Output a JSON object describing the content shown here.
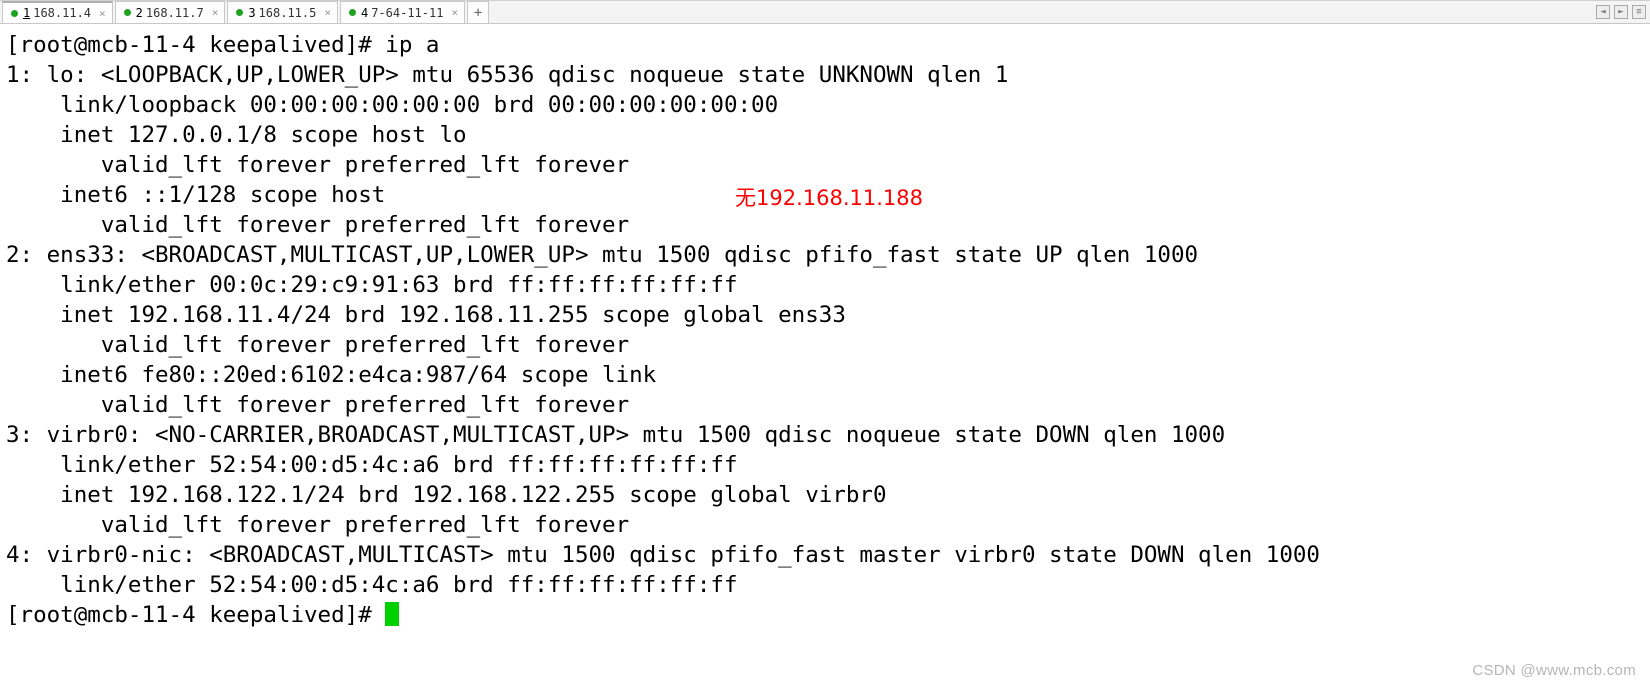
{
  "toolbar": {
    "hint": "",
    "tabs": [
      {
        "num": "1",
        "label": "168.11.4",
        "active": true
      },
      {
        "num": "2",
        "label": "168.11.7",
        "active": false
      },
      {
        "num": "3",
        "label": "168.11.5",
        "active": false
      },
      {
        "num": "4",
        "label": "7-64-11-11",
        "active": false
      }
    ],
    "add": "+",
    "close_glyph": "×",
    "right_icons": {
      "left": "◄",
      "right": "►",
      "menu": "≡"
    }
  },
  "term": {
    "prompt1": "[root@mcb-11-4 keepalived]# ip a",
    "lines": [
      "1: lo: <LOOPBACK,UP,LOWER_UP> mtu 65536 qdisc noqueue state UNKNOWN qlen 1",
      "    link/loopback 00:00:00:00:00:00 brd 00:00:00:00:00:00",
      "    inet 127.0.0.1/8 scope host lo",
      "       valid_lft forever preferred_lft forever",
      "    inet6 ::1/128 scope host ",
      "       valid_lft forever preferred_lft forever",
      "2: ens33: <BROADCAST,MULTICAST,UP,LOWER_UP> mtu 1500 qdisc pfifo_fast state UP qlen 1000",
      "    link/ether 00:0c:29:c9:91:63 brd ff:ff:ff:ff:ff:ff",
      "    inet 192.168.11.4/24 brd 192.168.11.255 scope global ens33",
      "       valid_lft forever preferred_lft forever",
      "    inet6 fe80::20ed:6102:e4ca:987/64 scope link ",
      "       valid_lft forever preferred_lft forever",
      "3: virbr0: <NO-CARRIER,BROADCAST,MULTICAST,UP> mtu 1500 qdisc noqueue state DOWN qlen 1000",
      "    link/ether 52:54:00:d5:4c:a6 brd ff:ff:ff:ff:ff:ff",
      "    inet 192.168.122.1/24 brd 192.168.122.255 scope global virbr0",
      "       valid_lft forever preferred_lft forever",
      "4: virbr0-nic: <BROADCAST,MULTICAST> mtu 1500 qdisc pfifo_fast master virbr0 state DOWN qlen 1000",
      "    link/ether 52:54:00:d5:4c:a6 brd ff:ff:ff:ff:ff:ff"
    ],
    "prompt2": "[root@mcb-11-4 keepalived]# ",
    "annotation": "无192.168.11.188"
  },
  "watermark": "CSDN @www.mcb.com"
}
